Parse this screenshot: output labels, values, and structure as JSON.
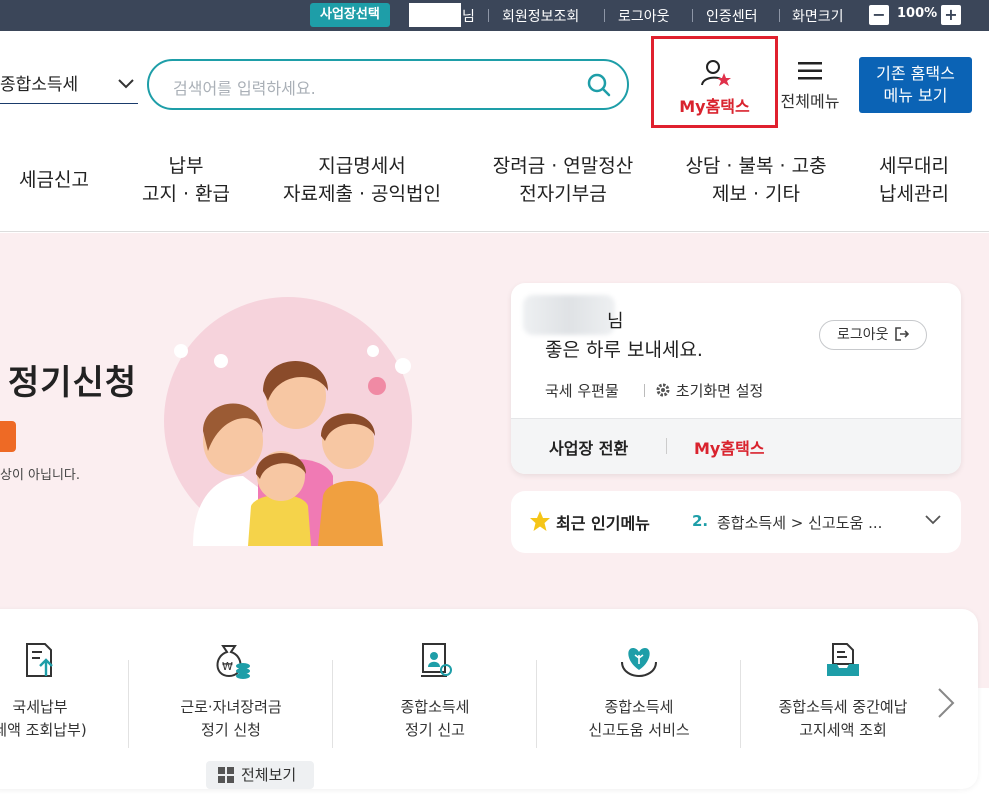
{
  "topbar": {
    "biz_select": "사업장선택",
    "nim": "님",
    "links": [
      "회원정보조회",
      "로그아웃",
      "인증센터",
      "화면크기"
    ],
    "zoom_minus": "−",
    "zoom_level": "100%",
    "zoom_plus": "+"
  },
  "header": {
    "tax_select": "종합소득세",
    "search_placeholder": "검색어를 입력하세요.",
    "my_hometax": "My홈택스",
    "all_menu": "전체메뉴",
    "old_btn_line1": "기존 홈택스",
    "old_btn_line2": "메뉴 보기"
  },
  "gnb": [
    {
      "l1": "세금신고",
      "l2": ""
    },
    {
      "l1": "납부",
      "l2": "고지 · 환급"
    },
    {
      "l1": "지급명세서",
      "l2": "자료제출 · 공익법인"
    },
    {
      "l1": "장려금 · 연말정산",
      "l2": "전자기부금"
    },
    {
      "l1": "상담 · 불복 · 고충",
      "l2": "제보 · 기타"
    },
    {
      "l1": "세무대리",
      "l2": "납세관리"
    }
  ],
  "hero": {
    "title": "정기신청",
    "note": "상이 아닙니다."
  },
  "user_card": {
    "name_suffix": "님",
    "greeting": "좋은 하루 보내세요.",
    "logout": "로그아웃",
    "mail": "국세 우편물",
    "setting": "초기화면 설정",
    "switch": "사업장 전환",
    "my_hometax": "My홈택스"
  },
  "popular": {
    "title": "최근 인기메뉴",
    "rank": "2.",
    "path": "종합소득세 > 신고도움 ..."
  },
  "quick": [
    {
      "label": "국세납부\n세액 조회납부)"
    },
    {
      "label": "근로·자녀장려금\n정기 신청"
    },
    {
      "label": "종합소득세\n정기 신고"
    },
    {
      "label": "종합소득세\n신고도움 서비스"
    },
    {
      "label": "종합소득세 중간예납\n고지세액 조회"
    }
  ],
  "view_all": "전체보기",
  "colors": {
    "teal": "#1e9ea8",
    "navy_bar": "#3b4659",
    "red": "#d9232e",
    "blue_btn": "#0b63b5",
    "hero_bg": "#fbeef0"
  }
}
